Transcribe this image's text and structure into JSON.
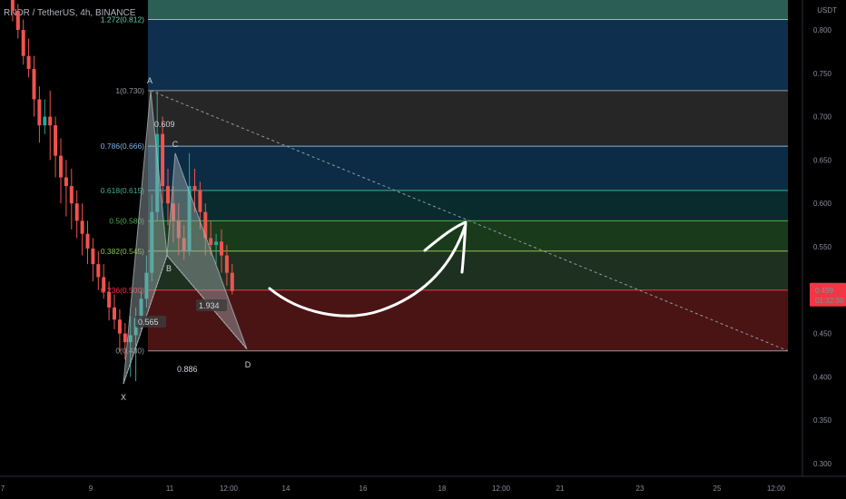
{
  "header": {
    "symbol_line": "RNDR / TetherUS, 4h, BINANCE"
  },
  "price_axis": {
    "currency": "USDT",
    "ticks": [
      "0.800",
      "0.750",
      "0.700",
      "0.650",
      "0.600",
      "0.550",
      "0.500",
      "0.450",
      "0.400",
      "0.350",
      "0.300"
    ],
    "current_price": "0.499",
    "countdown": "01:32:30",
    "current_color": "#f23645"
  },
  "time_axis": {
    "ticks": [
      "7",
      "9",
      "11",
      "12:00",
      "14",
      "16",
      "18",
      "12:00",
      "21",
      "23",
      "25",
      "12:00"
    ]
  },
  "chart_data": {
    "type": "candlestick",
    "title": "RNDR / TetherUS, 4h, BINANCE",
    "ylim": [
      0.295,
      0.825
    ],
    "fib_levels": [
      {
        "ratio": "1.272",
        "price": 0.812,
        "label": "1.272(0.812)",
        "color": "#6fd0b0",
        "fill": "#2b5f56"
      },
      {
        "ratio": "1",
        "price": 0.73,
        "label": "1(0.730)",
        "color": "#9598a1",
        "fill": "#0e2f4d"
      },
      {
        "ratio": "0.786",
        "price": 0.666,
        "label": "0.786(0.666)",
        "color": "#7fb3e0",
        "fill": "#262626"
      },
      {
        "ratio": "0.618",
        "price": 0.615,
        "label": "0.618(0.615)",
        "color": "#3fae8f",
        "fill": "#0b2c44"
      },
      {
        "ratio": "0.5",
        "price": 0.58,
        "label": "0.5(0.580)",
        "color": "#4caf50",
        "fill": "#0a2b2d"
      },
      {
        "ratio": "0.382",
        "price": 0.545,
        "label": "0.382(0.545)",
        "color": "#8bc34a",
        "fill": "#1a3a1c"
      },
      {
        "ratio": "0.236",
        "price": 0.5,
        "label": "0.236(0.500)",
        "color": "#f23645",
        "fill": "#1e3020"
      },
      {
        "ratio": "0",
        "price": 0.43,
        "label": "0(0.430)",
        "color": "#9598a1",
        "fill": "#4a1414"
      }
    ],
    "pattern_points": [
      {
        "name": "X",
        "value": 0.392
      },
      {
        "name": "A",
        "value": 0.73
      },
      {
        "name": "B",
        "value": 0.54
      },
      {
        "name": "C",
        "value": 0.658
      },
      {
        "name": "D",
        "value": 0.432
      }
    ],
    "pattern_ratios": [
      "0.609",
      "0.565",
      "1.934",
      "0.886"
    ]
  }
}
